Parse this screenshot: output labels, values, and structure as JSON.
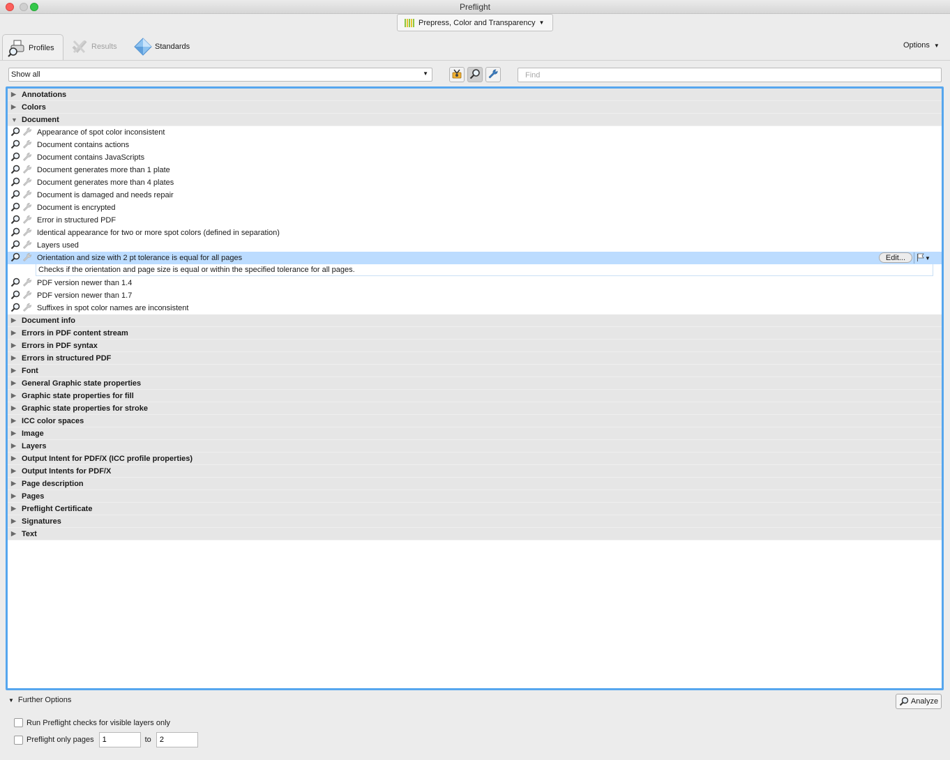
{
  "window": {
    "title": "Preflight"
  },
  "profile_selector": {
    "label": "Prepress, Color and Transparency"
  },
  "tabs": [
    {
      "label": "Profiles",
      "icon": "profiles-icon",
      "active": true
    },
    {
      "label": "Results",
      "icon": "results-icon",
      "active": false
    },
    {
      "label": "Standards",
      "icon": "standards-icon",
      "active": false
    }
  ],
  "options_label": "Options",
  "filter": {
    "selected": "Show all"
  },
  "toolbar": {
    "buttons": [
      "fixups-icon",
      "checks-icon",
      "profiles-wrench-icon"
    ]
  },
  "search": {
    "placeholder": "Find",
    "value": ""
  },
  "categories": [
    {
      "label": "Annotations",
      "expanded": false
    },
    {
      "label": "Colors",
      "expanded": false
    },
    {
      "label": "Document",
      "expanded": true
    },
    {
      "label": "Document info",
      "expanded": false
    },
    {
      "label": "Errors in PDF content stream",
      "expanded": false
    },
    {
      "label": "Errors in PDF syntax",
      "expanded": false
    },
    {
      "label": "Errors in structured PDF",
      "expanded": false
    },
    {
      "label": "Font",
      "expanded": false
    },
    {
      "label": "General Graphic state properties",
      "expanded": false
    },
    {
      "label": "Graphic state properties for fill",
      "expanded": false
    },
    {
      "label": "Graphic state properties for stroke",
      "expanded": false
    },
    {
      "label": "ICC color spaces",
      "expanded": false
    },
    {
      "label": "Image",
      "expanded": false
    },
    {
      "label": "Layers",
      "expanded": false
    },
    {
      "label": "Output Intent for PDF/X (ICC profile properties)",
      "expanded": false
    },
    {
      "label": "Output Intents for PDF/X",
      "expanded": false
    },
    {
      "label": "Page description",
      "expanded": false
    },
    {
      "label": "Pages",
      "expanded": false
    },
    {
      "label": "Preflight Certificate",
      "expanded": false
    },
    {
      "label": "Signatures",
      "expanded": false
    },
    {
      "label": "Text",
      "expanded": false
    }
  ],
  "document_items": [
    "Appearance of spot color inconsistent",
    "Document contains actions",
    "Document contains JavaScripts",
    "Document generates more than 1 plate",
    "Document generates more than 4 plates",
    "Document is damaged and needs repair",
    "Document is encrypted",
    "Error in structured PDF",
    "Identical appearance for two or more spot colors (defined in separation)",
    "Layers used",
    "Orientation and size with 2 pt tolerance is equal for all pages",
    "PDF version newer than 1.4",
    "PDF version newer than 1.7",
    "Suffixes in spot color names are inconsistent"
  ],
  "selected_item": {
    "index": 10,
    "description": "Checks if the orientation and page size is equal or within the specified tolerance for all pages.",
    "edit_label": "Edit..."
  },
  "bottom": {
    "further_options_label": "Further Options",
    "analyze_label": "Analyze",
    "visible_layers_label": "Run Preflight checks for visible layers only",
    "visible_layers_checked": false,
    "pages_label": "Preflight only pages",
    "pages_checked": false,
    "page_from": "1",
    "to_label": "to",
    "page_to": "2"
  },
  "colors": {
    "accent": "#56a6ee",
    "selection": "#bcdcff",
    "category_bg": "#e6e6e6"
  }
}
